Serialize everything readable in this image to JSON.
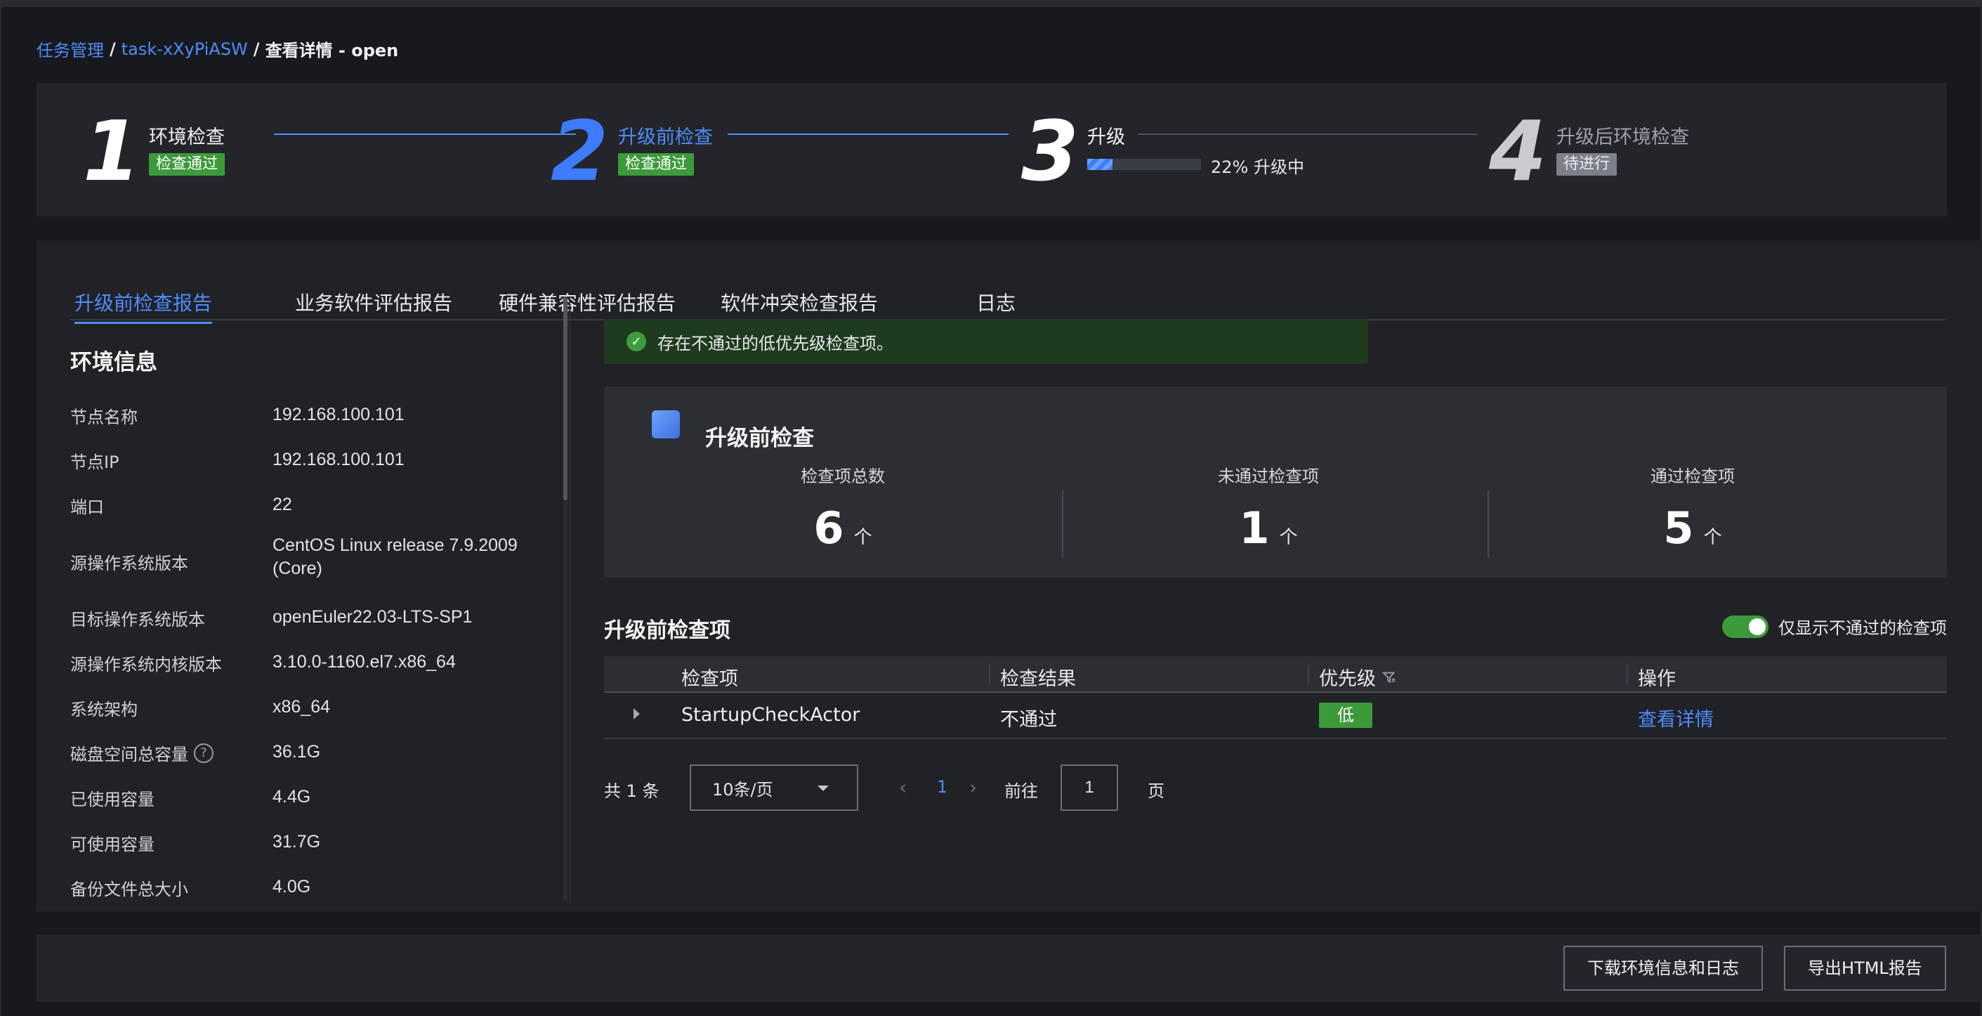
{
  "breadcrumb": {
    "root": "任务管理",
    "sep1": "/",
    "task": "task-xXyPiASW",
    "sep2": "/",
    "current": "查看详情 - open"
  },
  "steps": [
    {
      "num": "1",
      "title": "环境检查",
      "badge": "检查通过",
      "status": "pass"
    },
    {
      "num": "2",
      "title": "升级前检查",
      "badge": "检查通过",
      "status": "pass"
    },
    {
      "num": "3",
      "title": "升级",
      "progress": 22,
      "progress_text": "22% 升级中",
      "status": "running"
    },
    {
      "num": "4",
      "title": "升级后环境检查",
      "badge": "待进行",
      "status": "pending"
    }
  ],
  "tabs": [
    "升级前检查报告",
    "业务软件评估报告",
    "硬件兼容性评估报告",
    "软件冲突检查报告",
    "日志"
  ],
  "env": {
    "title": "环境信息",
    "rows": [
      {
        "label": "节点名称",
        "value": "192.168.100.101"
      },
      {
        "label": "节点IP",
        "value": "192.168.100.101"
      },
      {
        "label": "端口",
        "value": "22"
      },
      {
        "label": "源操作系统版本",
        "value": "CentOS Linux release 7.9.2009 (Core)"
      },
      {
        "label": "目标操作系统版本",
        "value": "openEuler22.03-LTS-SP1"
      },
      {
        "label": "源操作系统内核版本",
        "value": "3.10.0-1160.el7.x86_64"
      },
      {
        "label": "系统架构",
        "value": "x86_64"
      },
      {
        "label": "磁盘空间总容量",
        "value": "36.1G",
        "help": true
      },
      {
        "label": "已使用容量",
        "value": "4.4G"
      },
      {
        "label": "可使用容量",
        "value": "31.7G"
      },
      {
        "label": "备份文件总大小",
        "value": "4.0G"
      }
    ]
  },
  "alert": {
    "text": "存在不通过的低优先级检查项。",
    "icon": "check-circle-icon"
  },
  "summary": {
    "title": "升级前检查",
    "stats": [
      {
        "label": "检查项总数",
        "value": "6",
        "unit": "个"
      },
      {
        "label": "未通过检查项",
        "value": "1",
        "unit": "个"
      },
      {
        "label": "通过检查项",
        "value": "5",
        "unit": "个"
      }
    ]
  },
  "items_section": {
    "title": "升级前检查项",
    "toggle_label": "仅显示不通过的检查项",
    "toggle_on": true,
    "columns": [
      "检查项",
      "检查结果",
      "优先级",
      "操作"
    ],
    "rows": [
      {
        "item": "StartupCheckActor",
        "result": "不通过",
        "priority": "低",
        "action": "查看详情"
      }
    ]
  },
  "pagination": {
    "total": "共 1 条",
    "page_size": "10条/页",
    "prev": "‹",
    "current_page": "1",
    "next": "›",
    "goto_label": "前往",
    "goto_value": "1",
    "page_label": "页"
  },
  "footer": {
    "download_label": "下载环境信息和日志",
    "export_label": "导出HTML报告"
  },
  "colors": {
    "accent": "#4d8cff",
    "pass": "#3d9a3a",
    "pending": "#7d808a",
    "background": "#18191c",
    "panel": "#23252a"
  }
}
